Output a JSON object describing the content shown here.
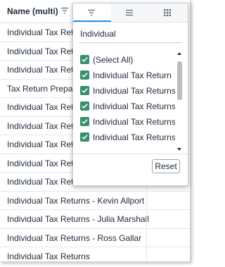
{
  "header": {
    "column_title": "Name (multi)"
  },
  "rows": [
    "Individual Tax Returns",
    "Individual Tax Returns",
    "Individual Tax Returns",
    "Tax Return Preparation",
    "Individual Tax Returns",
    "Individual Tax Returns",
    "Individual Tax Returns",
    "Individual Tax Returns",
    "Individual Tax Returns",
    "Individual Tax Returns - Kevin Allport",
    "Individual Tax Returns - Julia Marshall",
    "Individual Tax Returns - Ross Gallar",
    "Individual Tax Returns"
  ],
  "filter_popup": {
    "tabs": [
      {
        "icon": "filter-icon",
        "active": true
      },
      {
        "icon": "menu-icon",
        "active": false
      },
      {
        "icon": "columns-grid-icon",
        "active": false
      }
    ],
    "search_value": "Individual",
    "items": [
      {
        "label": "(Select All)",
        "checked": true
      },
      {
        "label": "Individual Tax Return",
        "checked": true
      },
      {
        "label": "Individual Tax Returns",
        "checked": true
      },
      {
        "label": "Individual Tax Returns - Brian",
        "checked": true
      },
      {
        "label": "Individual Tax Returns - Bill",
        "checked": true
      },
      {
        "label": "Individual Tax Returns - Chris",
        "checked": true
      }
    ],
    "reset_label": "Reset",
    "checkbox_color": "#3a8f6b",
    "accent_color": "#2196f3"
  }
}
